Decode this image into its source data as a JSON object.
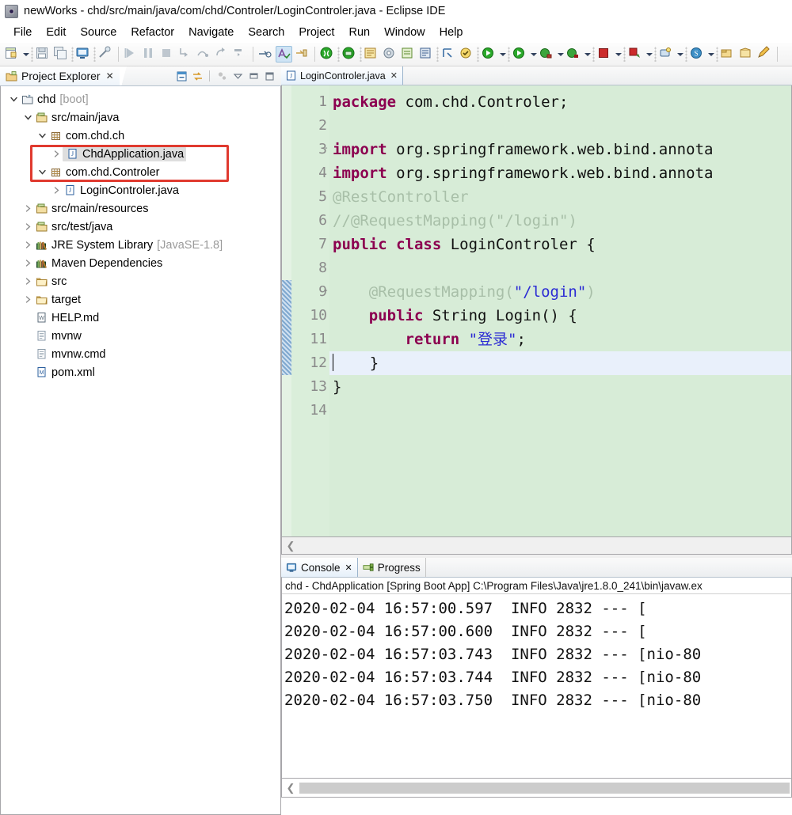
{
  "window": {
    "title": "newWorks - chd/src/main/java/com/chd/Controler/LoginControler.java - Eclipse IDE",
    "app_icon": "eclipse-icon"
  },
  "menubar": {
    "items": [
      {
        "label": "File"
      },
      {
        "label": "Edit"
      },
      {
        "label": "Source"
      },
      {
        "label": "Refactor"
      },
      {
        "label": "Navigate"
      },
      {
        "label": "Search"
      },
      {
        "label": "Project"
      },
      {
        "label": "Run"
      },
      {
        "label": "Window"
      },
      {
        "label": "Help"
      }
    ]
  },
  "toolbar": {
    "buttons": [
      {
        "name": "new-wizard-icon"
      },
      {
        "name": "new-wizard-dropdown-icon"
      },
      {
        "name": "save-icon"
      },
      {
        "name": "save-all-icon"
      },
      {
        "name": "open-console-icon"
      },
      {
        "name": "toggle-mark-occurrences-icon"
      },
      {
        "name": "resume-icon"
      },
      {
        "name": "suspend-icon"
      },
      {
        "name": "terminate-icon"
      },
      {
        "name": "step-into-icon"
      },
      {
        "name": "step-over-icon"
      },
      {
        "name": "step-return-icon"
      },
      {
        "name": "drop-to-frame-icon"
      },
      {
        "name": "build-all-icon"
      },
      {
        "name": "spell-check-icon"
      },
      {
        "name": "next-annotation-icon"
      },
      {
        "name": "new-java-project-icon"
      },
      {
        "name": "new-java-package-icon"
      },
      {
        "name": "new-class-icon"
      },
      {
        "name": "new-interface-icon"
      },
      {
        "name": "new-enum-icon"
      },
      {
        "name": "new-annotation-icon"
      },
      {
        "name": "search-icon"
      },
      {
        "name": "open-type-icon"
      },
      {
        "name": "external-tools-icon"
      },
      {
        "name": "external-tools-dropdown-icon"
      },
      {
        "name": "run-icon"
      },
      {
        "name": "run-dropdown-icon"
      },
      {
        "name": "debug-icon"
      },
      {
        "name": "debug-dropdown-icon"
      },
      {
        "name": "coverage-icon"
      },
      {
        "name": "coverage-dropdown-icon"
      },
      {
        "name": "stop-icon"
      },
      {
        "name": "stop-dropdown-icon"
      },
      {
        "name": "boot-dashboard-icon"
      },
      {
        "name": "boot-dashboard-dropdown-icon"
      },
      {
        "name": "new-connection-icon"
      },
      {
        "name": "new-connection-dropdown-icon"
      },
      {
        "name": "sonar-icon"
      },
      {
        "name": "sonar-dropdown-icon"
      },
      {
        "name": "open-perspective-icon"
      },
      {
        "name": "open-task-icon"
      },
      {
        "name": "pencil-icon"
      }
    ]
  },
  "explorer": {
    "tab": {
      "label": "Project Explorer",
      "icon": "project-explorer-icon",
      "close": "✕"
    },
    "tools": [
      {
        "name": "collapse-all-icon"
      },
      {
        "name": "link-with-editor-icon"
      },
      {
        "name": "focus-on-active-task-icon"
      },
      {
        "name": "view-menu-icon"
      },
      {
        "name": "minimize-view-icon"
      },
      {
        "name": "maximize-view-icon"
      }
    ],
    "tree": [
      {
        "indent": 0,
        "twisty": "expanded",
        "icon": "project-icon",
        "label": "chd",
        "sub": "[boot]",
        "selected": false
      },
      {
        "indent": 1,
        "twisty": "expanded",
        "icon": "source-folder-icon",
        "label": "src/main/java",
        "sub": "",
        "selected": false
      },
      {
        "indent": 2,
        "twisty": "expanded",
        "icon": "package-icon",
        "label": "com.chd.ch",
        "sub": "",
        "selected": false
      },
      {
        "indent": 3,
        "twisty": "collapsed",
        "icon": "java-file-icon",
        "label": "ChdApplication.java",
        "sub": "",
        "selected": true
      },
      {
        "indent": 2,
        "twisty": "expanded",
        "icon": "package-icon",
        "label": "com.chd.Controler",
        "sub": "",
        "selected": false
      },
      {
        "indent": 3,
        "twisty": "collapsed",
        "icon": "java-file-icon",
        "label": "LoginControler.java",
        "sub": "",
        "selected": false
      },
      {
        "indent": 1,
        "twisty": "collapsed",
        "icon": "source-folder-icon",
        "label": "src/main/resources",
        "sub": "",
        "selected": false
      },
      {
        "indent": 1,
        "twisty": "collapsed",
        "icon": "source-folder-icon",
        "label": "src/test/java",
        "sub": "",
        "selected": false
      },
      {
        "indent": 1,
        "twisty": "collapsed",
        "icon": "library-icon",
        "label": "JRE System Library",
        "sub": "[JavaSE-1.8]",
        "selected": false
      },
      {
        "indent": 1,
        "twisty": "collapsed",
        "icon": "library-icon",
        "label": "Maven Dependencies",
        "sub": "",
        "selected": false
      },
      {
        "indent": 1,
        "twisty": "collapsed",
        "icon": "folder-icon",
        "label": "src",
        "sub": "",
        "selected": false
      },
      {
        "indent": 1,
        "twisty": "collapsed",
        "icon": "folder-icon",
        "label": "target",
        "sub": "",
        "selected": false
      },
      {
        "indent": 1,
        "twisty": "none",
        "icon": "markdown-file-icon",
        "label": "HELP.md",
        "sub": "",
        "selected": false
      },
      {
        "indent": 1,
        "twisty": "none",
        "icon": "text-file-icon",
        "label": "mvnw",
        "sub": "",
        "selected": false
      },
      {
        "indent": 1,
        "twisty": "none",
        "icon": "text-file-icon",
        "label": "mvnw.cmd",
        "sub": "",
        "selected": false
      },
      {
        "indent": 1,
        "twisty": "none",
        "icon": "xml-file-icon",
        "label": "pom.xml",
        "sub": "",
        "selected": false
      }
    ],
    "highlight": {
      "color": "#e03a2f",
      "target": "com.chd.ch package and ChdApplication.java"
    }
  },
  "editor": {
    "tab": {
      "label": "LoginControler.java",
      "icon": "java-file-icon",
      "close": "✕"
    },
    "current_line": 12,
    "lines": [
      {
        "n": "1",
        "fold": "",
        "tokens": [
          {
            "t": "package ",
            "c": "k"
          },
          {
            "t": "com.chd.Controler;",
            "c": "plain"
          }
        ]
      },
      {
        "n": "2",
        "fold": "",
        "tokens": []
      },
      {
        "n": "3",
        "fold": "-",
        "tokens": [
          {
            "t": "import ",
            "c": "k"
          },
          {
            "t": "org.springframework.web.bind.annota",
            "c": "plain"
          }
        ]
      },
      {
        "n": "4",
        "fold": "",
        "tokens": [
          {
            "t": "import ",
            "c": "k"
          },
          {
            "t": "org.springframework.web.bind.annota",
            "c": "plain"
          }
        ]
      },
      {
        "n": "5",
        "fold": "",
        "tokens": [
          {
            "t": "@RestController",
            "c": "faded"
          }
        ]
      },
      {
        "n": "6",
        "fold": "",
        "tokens": [
          {
            "t": "//@RequestMapping(\"/login\")",
            "c": "faded"
          }
        ]
      },
      {
        "n": "7",
        "fold": "",
        "tokens": [
          {
            "t": "public class ",
            "c": "k"
          },
          {
            "t": "LoginControler {",
            "c": "plain"
          }
        ]
      },
      {
        "n": "8",
        "fold": "",
        "tokens": []
      },
      {
        "n": "9",
        "fold": "-",
        "tokens": [
          {
            "t": "    @RequestMapping(",
            "c": "faded"
          },
          {
            "t": "\"/login\"",
            "c": "str"
          },
          {
            "t": ")",
            "c": "faded"
          }
        ]
      },
      {
        "n": "10",
        "fold": "",
        "tokens": [
          {
            "t": "    public ",
            "c": "k"
          },
          {
            "t": "String Login() {",
            "c": "plain"
          }
        ]
      },
      {
        "n": "11",
        "fold": "",
        "tokens": [
          {
            "t": "        return ",
            "c": "k"
          },
          {
            "t": "\"登录\"",
            "c": "str"
          },
          {
            "t": ";",
            "c": "plain"
          }
        ]
      },
      {
        "n": "12",
        "fold": "",
        "tokens": [
          {
            "t": "    }",
            "c": "plain"
          }
        ]
      },
      {
        "n": "13",
        "fold": "",
        "tokens": [
          {
            "t": "}",
            "c": "plain"
          }
        ]
      },
      {
        "n": "14",
        "fold": "",
        "tokens": []
      }
    ],
    "marker_range": {
      "from_line": 9,
      "to_line": 12
    }
  },
  "console": {
    "tabs": [
      {
        "label": "Console",
        "icon": "console-icon",
        "active": true,
        "close": "✕"
      },
      {
        "label": "Progress",
        "icon": "progress-icon",
        "active": false,
        "close": ""
      }
    ],
    "header": "chd - ChdApplication [Spring Boot App] C:\\Program Files\\Java\\jre1.8.0_241\\bin\\javaw.ex",
    "lines": [
      "2020-02-04 16:57:00.597  INFO 2832 --- [",
      "2020-02-04 16:57:00.600  INFO 2832 --- [",
      "2020-02-04 16:57:03.743  INFO 2832 --- [nio-80",
      "2020-02-04 16:57:03.744  INFO 2832 --- [nio-80",
      "2020-02-04 16:57:03.750  INFO 2832 --- [nio-80"
    ],
    "scroll_left_arrow": "❮"
  },
  "colors": {
    "editor_background": "#d7ecd7",
    "current_line": "#e9f0fb",
    "keyword": "#8c0050",
    "string": "#2b2bd4",
    "comment": "#9fb79f",
    "highlight_box": "#e03a2f",
    "selection": "#dedede"
  }
}
